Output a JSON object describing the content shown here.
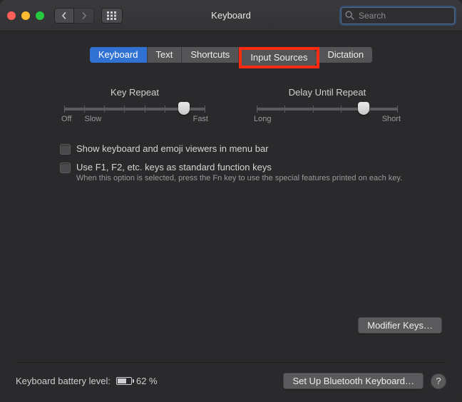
{
  "title": "Keyboard",
  "search": {
    "placeholder": "Search"
  },
  "tabs": {
    "keyboard": "Keyboard",
    "text": "Text",
    "shortcuts": "Shortcuts",
    "input_sources": "Input Sources",
    "dictation": "Dictation"
  },
  "sliders": {
    "key_repeat": {
      "title": "Key Repeat",
      "min_label": "Off",
      "mid_label": "Slow",
      "max_label": "Fast",
      "thumb_pct": 85
    },
    "delay_repeat": {
      "title": "Delay Until Repeat",
      "min_label": "Long",
      "max_label": "Short",
      "thumb_pct": 76
    }
  },
  "checks": {
    "show_viewers": "Show keyboard and emoji viewers in menu bar",
    "fn_keys": "Use F1, F2, etc. keys as standard function keys",
    "fn_help": "When this option is selected, press the Fn key to use the special features printed on each key."
  },
  "buttons": {
    "modifier_keys": "Modifier Keys…",
    "bluetooth": "Set Up Bluetooth Keyboard…"
  },
  "footer": {
    "battery_label": "Keyboard battery level:",
    "battery_pct_text": "62 %",
    "battery_fill_pct": 62
  },
  "help_glyph": "?"
}
